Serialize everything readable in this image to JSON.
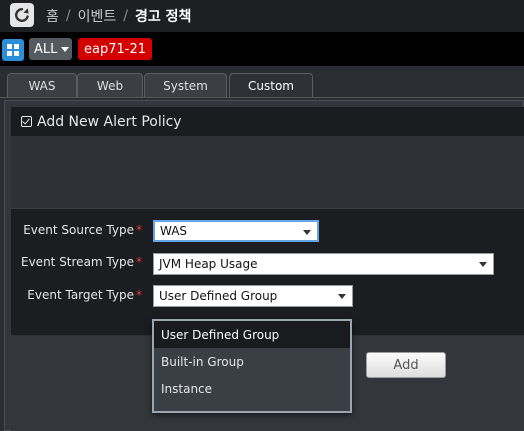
{
  "breadcrumb": {
    "home": "홈",
    "section": "이벤트",
    "current": "경고 정책",
    "separator": "/"
  },
  "selector": {
    "scope": "ALL",
    "agent": "eap71-21"
  },
  "tabs": [
    {
      "label": "WAS",
      "active": false
    },
    {
      "label": "Web",
      "active": false
    },
    {
      "label": "System",
      "active": false
    },
    {
      "label": "Custom",
      "active": true
    }
  ],
  "panel": {
    "title": "Add New Alert Policy"
  },
  "form": {
    "required_mark": "*",
    "event_source": {
      "label": "Event Source Type",
      "value": "WAS"
    },
    "event_stream": {
      "label": "Event Stream Type",
      "value": "JVM Heap Usage"
    },
    "event_target": {
      "label": "Event Target Type",
      "value": "User Defined Group"
    }
  },
  "dropdown": {
    "options": [
      "User Defined Group",
      "Built-in Group",
      "Instance"
    ],
    "selected_index": 0
  },
  "actions": {
    "add_label": "Add"
  },
  "colors": {
    "accent_blue": "#2a8ed8",
    "agent_badge": "#d40000",
    "required": "#e23c3c"
  }
}
